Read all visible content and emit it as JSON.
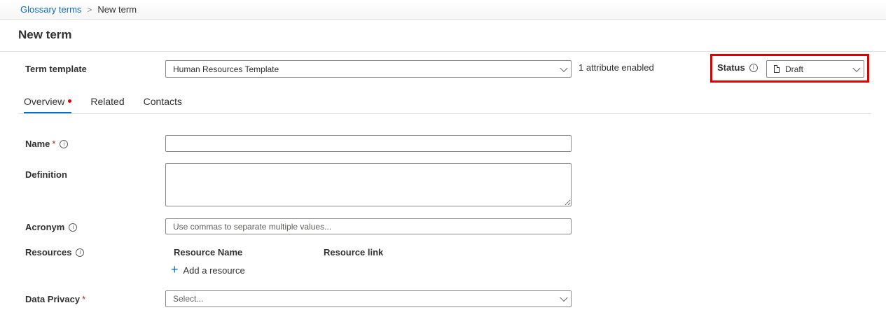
{
  "breadcrumb": {
    "parent": "Glossary terms",
    "separator": ">",
    "current": "New term"
  },
  "page_title": "New term",
  "term_template": {
    "label": "Term template",
    "value": "Human Resources Template",
    "note": "1 attribute enabled"
  },
  "status": {
    "label": "Status",
    "value": "Draft"
  },
  "tabs": [
    {
      "label": "Overview"
    },
    {
      "label": "Related"
    },
    {
      "label": "Contacts"
    }
  ],
  "fields": {
    "name": {
      "label": "Name",
      "required": "*",
      "value": ""
    },
    "definition": {
      "label": "Definition",
      "value": ""
    },
    "acronym": {
      "label": "Acronym",
      "placeholder": "Use commas to separate multiple values..."
    },
    "resources": {
      "label": "Resources",
      "col_name": "Resource Name",
      "col_link": "Resource link",
      "add": "Add a resource"
    },
    "data_privacy": {
      "label": "Data Privacy",
      "required": "*",
      "placeholder": "Select..."
    }
  },
  "icons": {
    "info": "i",
    "plus": "+"
  },
  "colors": {
    "accent": "#0f6cbd",
    "highlight": "#e00000",
    "required": "#a4262c"
  }
}
